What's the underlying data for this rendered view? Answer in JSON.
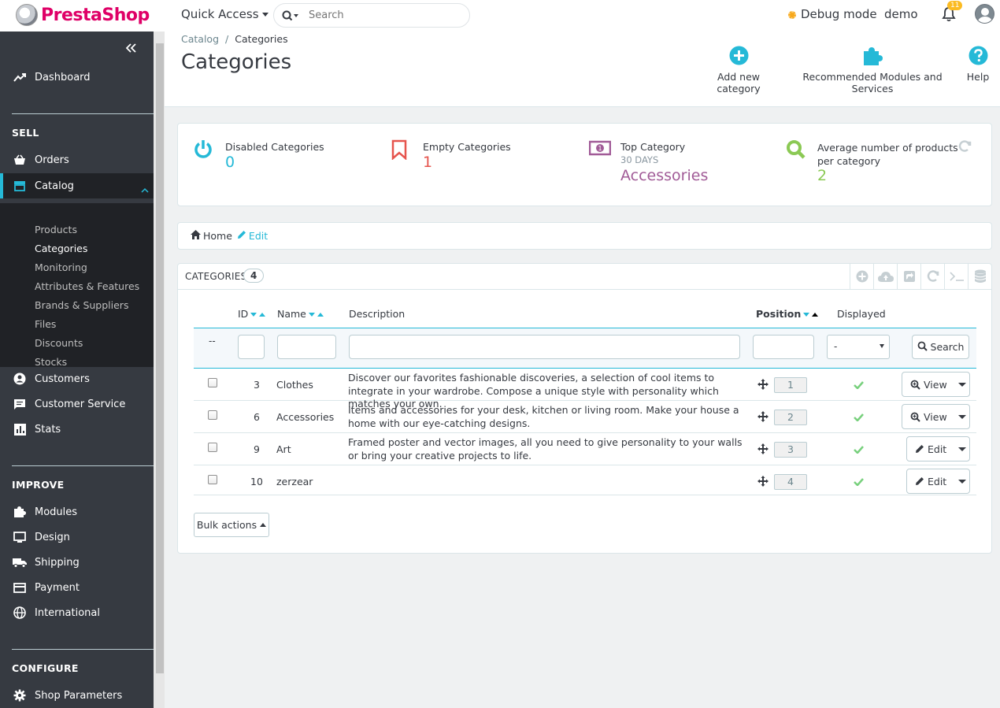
{
  "header": {
    "brand": "PrestaShop",
    "quick_access": "Quick Access",
    "search_placeholder": "Search",
    "debug_mode": "Debug mode",
    "shop_name": "demo",
    "notifications_count": "11"
  },
  "sidebar": {
    "dashboard": "Dashboard",
    "section_sell": "SELL",
    "orders": "Orders",
    "catalog": "Catalog",
    "catalog_sub": [
      "Products",
      "Categories",
      "Monitoring",
      "Attributes & Features",
      "Brands & Suppliers",
      "Files",
      "Discounts",
      "Stocks"
    ],
    "customers": "Customers",
    "customer_service": "Customer Service",
    "stats": "Stats",
    "section_improve": "IMPROVE",
    "modules": "Modules",
    "design": "Design",
    "shipping": "Shipping",
    "payment": "Payment",
    "international": "International",
    "section_configure": "CONFIGURE",
    "shop_parameters": "Shop Parameters"
  },
  "page": {
    "breadcrumb": [
      "Catalog",
      "Categories"
    ],
    "title": "Categories",
    "toolbar": {
      "add": "Add new category",
      "modules": "Recommended Modules and Services",
      "help": "Help"
    }
  },
  "kpis": [
    {
      "title": "Disabled Categories",
      "value": "0",
      "color": "#25b9d7"
    },
    {
      "title": "Empty Categories",
      "value": "1",
      "color": "#e6544d"
    },
    {
      "title": "Top Category",
      "subtitle": "30 DAYS",
      "value": "Accessories",
      "color": "#a15b97"
    },
    {
      "title": "Average number of products per category",
      "value": "2",
      "color": "#8bc954"
    }
  ],
  "home_bar": {
    "home": "Home",
    "edit": "Edit"
  },
  "list": {
    "title": "CATEGORIES",
    "count": "4",
    "columns": {
      "id": "ID",
      "name": "Name",
      "description": "Description",
      "position": "Position",
      "displayed": "Displayed"
    },
    "filter": {
      "bulk": "--",
      "displayed_value": "-",
      "search": "Search"
    },
    "rows": [
      {
        "id": "3",
        "name": "Clothes",
        "description": "Discover our favorites fashionable discoveries, a selection of cool items to integrate in your wardrobe. Compose a unique style with personality which matches your own.",
        "position": "1",
        "action": "View"
      },
      {
        "id": "6",
        "name": "Accessories",
        "description": "Items and accessories for your desk, kitchen or living room. Make your house a home with our eye-catching designs.",
        "position": "2",
        "action": "View"
      },
      {
        "id": "9",
        "name": "Art",
        "description": "Framed poster and vector images, all you need to give personality to your walls or bring your creative projects to life.",
        "position": "3",
        "action": "Edit"
      },
      {
        "id": "10",
        "name": "zerzear",
        "description": "",
        "position": "4",
        "action": "Edit"
      }
    ],
    "bulk_actions": "Bulk actions"
  },
  "colors": {
    "accent": "#25b9d7",
    "sidebar": "#363a41",
    "sidebar_active": "#202226"
  }
}
